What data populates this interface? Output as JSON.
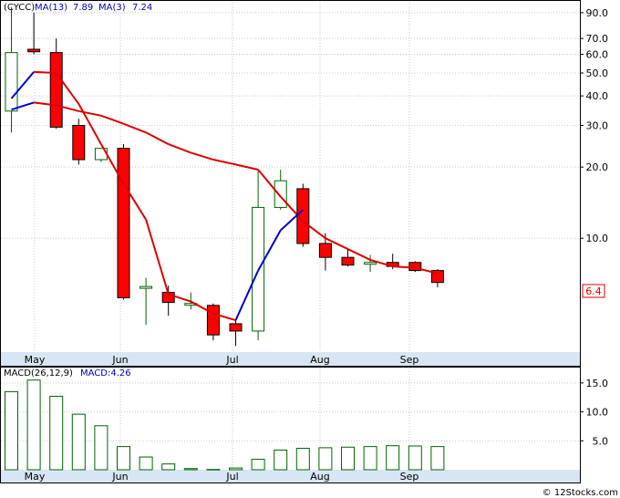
{
  "chart_data": [
    {
      "type": "candlestick",
      "symbol": "(CYCC)",
      "legend": {
        "ma13_label": "MA(13)",
        "ma13_value": "7.89",
        "ma3_label": "MA(3)",
        "ma3_value": "7.24"
      },
      "y_scale": "log",
      "ylim": [
        3.3,
        100
      ],
      "y_ticks": [
        "90.0",
        "70.0",
        "60.0",
        "50.0",
        "40.0",
        "30.0",
        "20.0",
        "10.0"
      ],
      "x_ticks": [
        "May",
        "Jun",
        "Jul",
        "Aug",
        "Sep"
      ],
      "last_price_label": "6.4",
      "candles": [
        {
          "o": 34.5,
          "h": 95,
          "l": 28,
          "c": 61
        },
        {
          "o": 63,
          "h": 90,
          "l": 60,
          "c": 61.5
        },
        {
          "o": 61,
          "h": 70,
          "l": 29,
          "c": 29.5
        },
        {
          "o": 30,
          "h": 32,
          "l": 20.5,
          "c": 21.5
        },
        {
          "o": 21.5,
          "h": 24,
          "l": 21,
          "c": 24
        },
        {
          "o": 24,
          "h": 25,
          "l": 5.5,
          "c": 5.6
        },
        {
          "o": 6.15,
          "h": 6.8,
          "l": 4.3,
          "c": 6.25
        },
        {
          "o": 5.9,
          "h": 6.3,
          "l": 4.7,
          "c": 5.35
        },
        {
          "o": 5.25,
          "h": 5.9,
          "l": 5.0,
          "c": 5.3
        },
        {
          "o": 5.2,
          "h": 5.3,
          "l": 3.7,
          "c": 3.9
        },
        {
          "o": 4.35,
          "h": 4.5,
          "l": 3.5,
          "c": 4.05
        },
        {
          "o": 4.05,
          "h": 19.5,
          "l": 3.7,
          "c": 13.5
        },
        {
          "o": 13.5,
          "h": 19.5,
          "l": 13.2,
          "c": 17.5
        },
        {
          "o": 16.2,
          "h": 17.0,
          "l": 9.2,
          "c": 9.5
        },
        {
          "o": 9.5,
          "h": 10.5,
          "l": 7.3,
          "c": 8.3
        },
        {
          "o": 8.3,
          "h": 9.0,
          "l": 7.6,
          "c": 7.7
        },
        {
          "o": 7.8,
          "h": 8.5,
          "l": 7.2,
          "c": 7.9
        },
        {
          "o": 7.9,
          "h": 8.6,
          "l": 7.4,
          "c": 7.6
        },
        {
          "o": 7.9,
          "h": 8.0,
          "l": 7.2,
          "c": 7.3
        },
        {
          "o": 7.3,
          "h": 7.4,
          "l": 6.2,
          "c": 6.5
        }
      ],
      "ma3": [
        39,
        50.5,
        50,
        37,
        25,
        17,
        12,
        5.8,
        5.4,
        4.8,
        4.5,
        7.3,
        10.8,
        13.2
      ],
      "ma13": [
        35,
        37.5,
        36.5,
        34.5,
        33,
        30.5,
        28,
        25,
        23,
        21.5,
        20.5,
        19.5,
        15,
        11.8,
        10,
        9,
        8.1,
        7.6,
        7.5,
        7.1
      ],
      "ma13_colors": {
        "up": "#0000d0",
        "down": "#dd0000"
      },
      "ma3_colors": {
        "up": "#0000d0",
        "down": "#dd0000"
      },
      "up_color": "#ffffff",
      "down_color": "#ff0000",
      "grid": true
    },
    {
      "type": "bar",
      "indicator": "MACD(26,12,9)",
      "value_label": "MACD:4.26",
      "ylim": [
        0,
        17.5
      ],
      "y_ticks": [
        "15.0",
        "10.0",
        "5.0"
      ],
      "x_ticks": [
        "May",
        "Jun",
        "Jul",
        "Aug",
        "Sep"
      ],
      "values": [
        13.5,
        15.5,
        12.7,
        9.6,
        7.6,
        4.0,
        2.2,
        1.0,
        0.2,
        0.05,
        0.3,
        1.8,
        3.4,
        3.7,
        3.8,
        3.9,
        4.0,
        4.15,
        4.1,
        4.0
      ],
      "bar_color": "#006400",
      "grid": true
    }
  ],
  "footer": {
    "watermark": "© 12Stocks.com"
  }
}
